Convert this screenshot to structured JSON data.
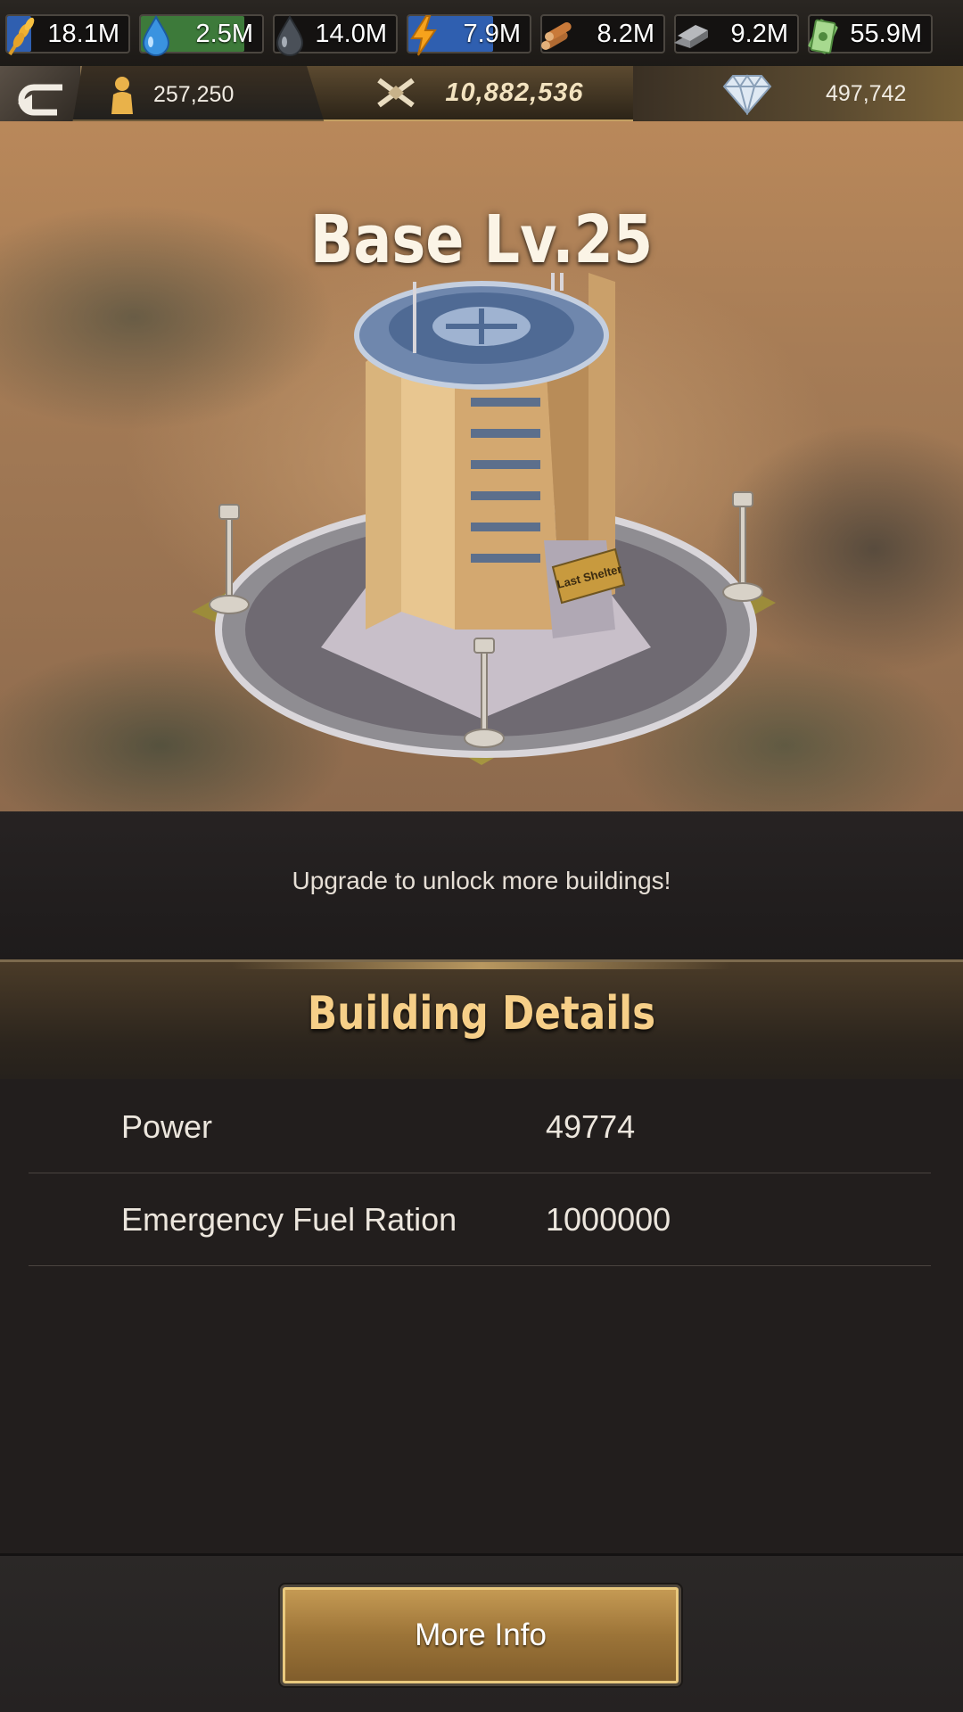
{
  "resources": [
    {
      "name": "food",
      "icon": "wheat-icon",
      "value": "18.1M",
      "fill": 0.2,
      "color": "#2f5fb0"
    },
    {
      "name": "water",
      "icon": "water-drop-icon",
      "value": "2.5M",
      "fill": 0.85,
      "color": "#3d7a3a"
    },
    {
      "name": "oil",
      "icon": "oil-drop-icon",
      "value": "14.0M",
      "fill": 0.0,
      "color": "#2f5fb0"
    },
    {
      "name": "electricity",
      "icon": "lightning-icon",
      "value": "7.9M",
      "fill": 0.7,
      "color": "#2f5fb0"
    },
    {
      "name": "wood",
      "icon": "logs-icon",
      "value": "8.2M",
      "fill": 0.0,
      "color": "#2f5fb0"
    },
    {
      "name": "metal",
      "icon": "metal-bars-icon",
      "value": "9.2M",
      "fill": 0.0,
      "color": "#2f5fb0"
    },
    {
      "name": "cash",
      "icon": "cash-stack-icon",
      "value": "55.9M",
      "fill": 0.0,
      "color": "#2f5fb0"
    }
  ],
  "currency": {
    "survivors": "257,250",
    "power": "10,882,536",
    "diamonds": "497,742"
  },
  "building": {
    "title": "Base Lv.25",
    "sign": "Last Shelter",
    "upgrade_hint": "Upgrade to unlock more buildings!"
  },
  "details": {
    "title": "Building Details",
    "rows": [
      {
        "key": "Power",
        "value": "49774"
      },
      {
        "key": "Emergency Fuel Ration",
        "value": "1000000"
      }
    ]
  },
  "footer": {
    "more_info_label": "More Info"
  },
  "colors": {
    "accent_gold": "#f6cf88",
    "button_gold": "#9c7438"
  }
}
